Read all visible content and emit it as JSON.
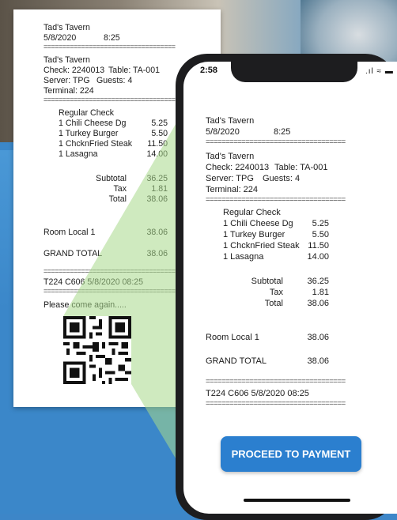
{
  "receipt": {
    "store": "Tad's Tavern",
    "date": "5/8/2020",
    "time": "8:25",
    "separator": "===================================",
    "store2": "Tad's Tavern",
    "check": "Check: 2240013",
    "table": "Table: TA-001",
    "server": "Server: TPG",
    "guests": "Guests: 4",
    "terminal": "Terminal: 224",
    "section": "Regular Check",
    "items": [
      {
        "name": "1 Chili Cheese Dg",
        "price": "5.25"
      },
      {
        "name": "1 Turkey Burger",
        "price": "5.50"
      },
      {
        "name": "1 ChcknFried Steak",
        "price": "11.50"
      },
      {
        "name": "1 Lasagna",
        "price": "14.00"
      }
    ],
    "subtotal_label": "Subtotal",
    "subtotal": "36.25",
    "tax_label": "Tax",
    "tax": "1.81",
    "total_label": "Total",
    "total": "38.06",
    "room_label": "Room Local 1",
    "room_value": "38.06",
    "grand_label": "GRAND TOTAL",
    "grand_value": "38.06",
    "footer_code": "T224 C606 5/8/2020 08:25",
    "thanks": "Please come again....."
  },
  "phone": {
    "status_time": "2:58",
    "status_icons": ".ıl ≈ ▬",
    "pay_button": "PROCEED TO PAYMENT"
  }
}
